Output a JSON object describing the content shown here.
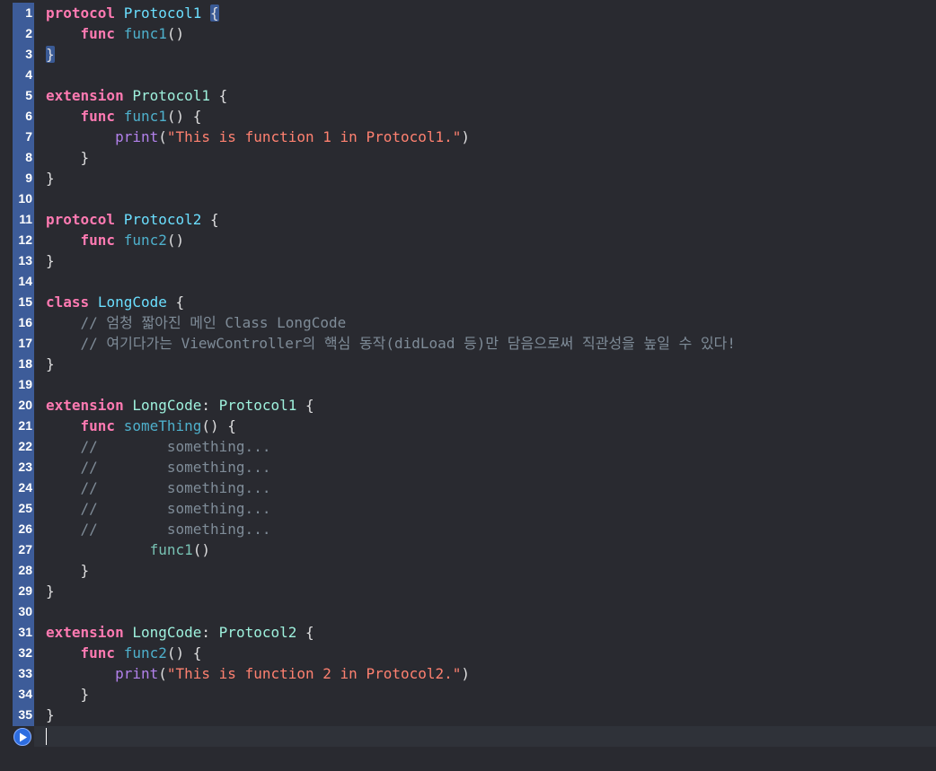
{
  "editor": {
    "language": "Swift",
    "theme_colors": {
      "background": "#292a30",
      "keyword": "#ff7ab2",
      "type": "#6bdfff",
      "function": "#4eb0cc",
      "builtin": "#b281eb",
      "string": "#ff8170",
      "number": "#d9c97c",
      "comment": "#7f8c98",
      "plain": "#dfdfe0",
      "gutter_selection": "#3d5c99"
    },
    "run_button_icon": "play-icon",
    "lines": [
      {
        "num": "1",
        "tokens": [
          {
            "t": "protocol",
            "c": "kw"
          },
          {
            "t": " "
          },
          {
            "t": "Protocol1",
            "c": "type"
          },
          {
            "t": " "
          },
          {
            "t": "{",
            "c": "plain",
            "hl": true
          }
        ]
      },
      {
        "num": "2",
        "tokens": [
          {
            "t": "    "
          },
          {
            "t": "func",
            "c": "kw"
          },
          {
            "t": " "
          },
          {
            "t": "func1",
            "c": "func"
          },
          {
            "t": "()",
            "c": "plain"
          }
        ]
      },
      {
        "num": "3",
        "tokens": [
          {
            "t": "}",
            "c": "plain",
            "hl": true
          }
        ]
      },
      {
        "num": "4",
        "tokens": []
      },
      {
        "num": "5",
        "tokens": [
          {
            "t": "extension",
            "c": "kw"
          },
          {
            "t": " "
          },
          {
            "t": "Protocol1",
            "c": "typeb"
          },
          {
            "t": " {",
            "c": "plain"
          }
        ]
      },
      {
        "num": "6",
        "tokens": [
          {
            "t": "    "
          },
          {
            "t": "func",
            "c": "kw"
          },
          {
            "t": " "
          },
          {
            "t": "func1",
            "c": "func"
          },
          {
            "t": "() {",
            "c": "plain"
          }
        ]
      },
      {
        "num": "7",
        "tokens": [
          {
            "t": "        "
          },
          {
            "t": "print",
            "c": "builtin"
          },
          {
            "t": "(",
            "c": "plain"
          },
          {
            "t": "\"This is function ",
            "c": "str"
          },
          {
            "t": "1",
            "c": "str"
          },
          {
            "t": " in Protocol1.\"",
            "c": "str"
          },
          {
            "t": ")",
            "c": "plain"
          }
        ]
      },
      {
        "num": "8",
        "tokens": [
          {
            "t": "    }",
            "c": "plain"
          }
        ]
      },
      {
        "num": "9",
        "tokens": [
          {
            "t": "}",
            "c": "plain"
          }
        ]
      },
      {
        "num": "10",
        "tokens": []
      },
      {
        "num": "11",
        "tokens": [
          {
            "t": "protocol",
            "c": "kw"
          },
          {
            "t": " "
          },
          {
            "t": "Protocol2",
            "c": "type"
          },
          {
            "t": " {",
            "c": "plain"
          }
        ]
      },
      {
        "num": "12",
        "tokens": [
          {
            "t": "    "
          },
          {
            "t": "func",
            "c": "kw"
          },
          {
            "t": " "
          },
          {
            "t": "func2",
            "c": "func"
          },
          {
            "t": "()",
            "c": "plain"
          }
        ]
      },
      {
        "num": "13",
        "tokens": [
          {
            "t": "}",
            "c": "plain"
          }
        ]
      },
      {
        "num": "14",
        "tokens": []
      },
      {
        "num": "15",
        "tokens": [
          {
            "t": "class",
            "c": "kw"
          },
          {
            "t": " "
          },
          {
            "t": "LongCode",
            "c": "type"
          },
          {
            "t": " {",
            "c": "plain"
          }
        ]
      },
      {
        "num": "16",
        "tokens": [
          {
            "t": "    "
          },
          {
            "t": "// 엄청 짧아진 메인 Class LongCode",
            "c": "cmt"
          }
        ]
      },
      {
        "num": "17",
        "tokens": [
          {
            "t": "    "
          },
          {
            "t": "// 여기다가는 ViewController의 핵심 동작(didLoad 등)만 담음으로써 직관성을 높일 수 있다!",
            "c": "cmt"
          }
        ]
      },
      {
        "num": "18",
        "tokens": [
          {
            "t": "}",
            "c": "plain"
          }
        ]
      },
      {
        "num": "19",
        "tokens": []
      },
      {
        "num": "20",
        "tokens": [
          {
            "t": "extension",
            "c": "kw"
          },
          {
            "t": " "
          },
          {
            "t": "LongCode",
            "c": "typeb"
          },
          {
            "t": ": ",
            "c": "plain"
          },
          {
            "t": "Protocol1",
            "c": "typeb"
          },
          {
            "t": " {",
            "c": "plain"
          }
        ]
      },
      {
        "num": "21",
        "tokens": [
          {
            "t": "    "
          },
          {
            "t": "func",
            "c": "kw"
          },
          {
            "t": " "
          },
          {
            "t": "someThing",
            "c": "func"
          },
          {
            "t": "() {",
            "c": "plain"
          }
        ]
      },
      {
        "num": "22",
        "tokens": [
          {
            "t": "    "
          },
          {
            "t": "//        something...",
            "c": "cmt"
          }
        ]
      },
      {
        "num": "23",
        "tokens": [
          {
            "t": "    "
          },
          {
            "t": "//        something...",
            "c": "cmt"
          }
        ]
      },
      {
        "num": "24",
        "tokens": [
          {
            "t": "    "
          },
          {
            "t": "//        something...",
            "c": "cmt"
          }
        ]
      },
      {
        "num": "25",
        "tokens": [
          {
            "t": "    "
          },
          {
            "t": "//        something...",
            "c": "cmt"
          }
        ]
      },
      {
        "num": "26",
        "tokens": [
          {
            "t": "    "
          },
          {
            "t": "//        something...",
            "c": "cmt"
          }
        ]
      },
      {
        "num": "27",
        "tokens": [
          {
            "t": "            "
          },
          {
            "t": "func1",
            "c": "func2"
          },
          {
            "t": "()",
            "c": "plain"
          }
        ]
      },
      {
        "num": "28",
        "tokens": [
          {
            "t": "    }",
            "c": "plain"
          }
        ]
      },
      {
        "num": "29",
        "tokens": [
          {
            "t": "}",
            "c": "plain"
          }
        ]
      },
      {
        "num": "30",
        "tokens": []
      },
      {
        "num": "31",
        "tokens": [
          {
            "t": "extension",
            "c": "kw"
          },
          {
            "t": " "
          },
          {
            "t": "LongCode",
            "c": "typeb"
          },
          {
            "t": ": ",
            "c": "plain"
          },
          {
            "t": "Protocol2",
            "c": "typeb"
          },
          {
            "t": " {",
            "c": "plain"
          }
        ]
      },
      {
        "num": "32",
        "tokens": [
          {
            "t": "    "
          },
          {
            "t": "func",
            "c": "kw"
          },
          {
            "t": " "
          },
          {
            "t": "func2",
            "c": "func"
          },
          {
            "t": "() {",
            "c": "plain"
          }
        ]
      },
      {
        "num": "33",
        "tokens": [
          {
            "t": "        "
          },
          {
            "t": "print",
            "c": "builtin"
          },
          {
            "t": "(",
            "c": "plain"
          },
          {
            "t": "\"This is function ",
            "c": "str"
          },
          {
            "t": "2",
            "c": "str"
          },
          {
            "t": " in Protocol2.\"",
            "c": "str"
          },
          {
            "t": ")",
            "c": "plain"
          }
        ]
      },
      {
        "num": "34",
        "tokens": [
          {
            "t": "    }",
            "c": "plain"
          }
        ]
      },
      {
        "num": "35",
        "tokens": [
          {
            "t": "}",
            "c": "plain"
          }
        ]
      }
    ]
  }
}
